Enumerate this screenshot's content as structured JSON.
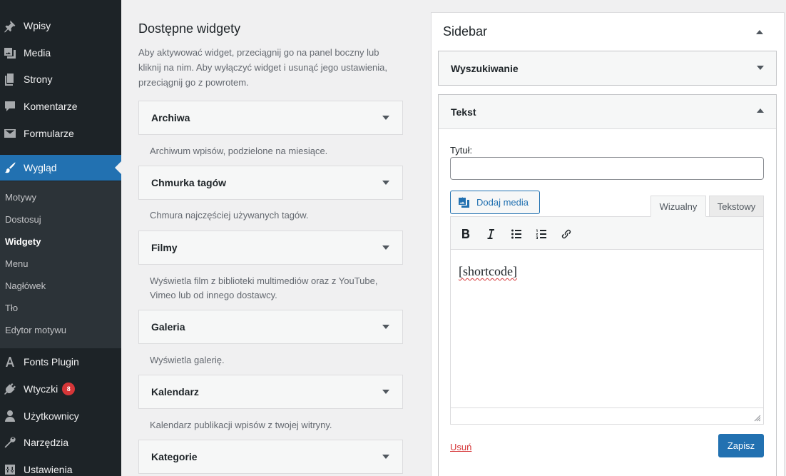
{
  "admin_menu": {
    "items": [
      {
        "label": "Wpisy",
        "icon": "pin-icon"
      },
      {
        "label": "Media",
        "icon": "media-icon"
      },
      {
        "label": "Strony",
        "icon": "pages-icon"
      },
      {
        "label": "Komentarze",
        "icon": "comments-icon"
      },
      {
        "label": "Formularze",
        "icon": "envelope-icon"
      },
      {
        "label": "Wygląd",
        "icon": "brush-icon"
      },
      {
        "label": "Fonts Plugin",
        "icon": "font-icon"
      },
      {
        "label": "Wtyczki",
        "icon": "plugin-icon",
        "badge": "8"
      },
      {
        "label": "Użytkownicy",
        "icon": "user-icon"
      },
      {
        "label": "Narzędzia",
        "icon": "wrench-icon"
      },
      {
        "label": "Ustawienia",
        "icon": "settings-icon"
      }
    ],
    "submenu": [
      "Motywy",
      "Dostosuj",
      "Widgety",
      "Menu",
      "Nagłówek",
      "Tło",
      "Edytor motywu"
    ],
    "current_submenu": "Widgety"
  },
  "available_widgets": {
    "title": "Dostępne widgety",
    "description": "Aby aktywować widget, przeciągnij go na panel boczny lub kliknij na nim. Aby wyłączyć widget i usunąć jego ustawienia, przeciągnij go z powrotem.",
    "widgets": [
      {
        "title": "Archiwa",
        "description": "Archiwum wpisów, podzielone na miesiące."
      },
      {
        "title": "Chmurka tagów",
        "description": "Chmura najczęściej używanych tagów."
      },
      {
        "title": "Filmy",
        "description": "Wyświetla film z biblioteki multimediów oraz z YouTube, Vimeo lub od innego dostawcy."
      },
      {
        "title": "Galeria",
        "description": "Wyświetla galerię."
      },
      {
        "title": "Kalendarz",
        "description": "Kalendarz publikacji wpisów z twojej witryny."
      },
      {
        "title": "Kategorie",
        "description": ""
      }
    ]
  },
  "sidebar": {
    "title": "Sidebar",
    "search_widget": {
      "title": "Wyszukiwanie"
    },
    "text_widget": {
      "title": "Tekst",
      "title_label": "Tytuł:",
      "title_value": "",
      "add_media_label": "Dodaj media",
      "tab_visual": "Wizualny",
      "tab_text": "Tekstowy",
      "content": "[shortcode]",
      "delete_label": "Usuń",
      "save_label": "Zapisz"
    }
  },
  "colors": {
    "admin_bg": "#1d2327",
    "submenu_bg": "#2c3338",
    "accent": "#2271b1",
    "danger": "#d63638"
  }
}
